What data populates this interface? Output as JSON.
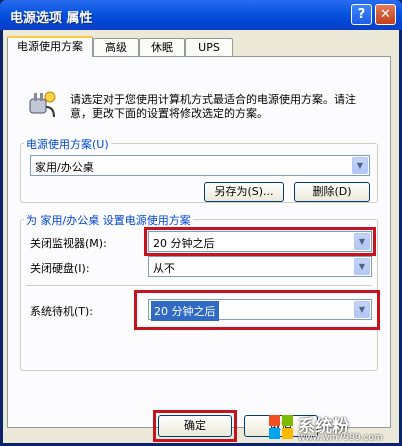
{
  "window": {
    "title": "电源选项 属性"
  },
  "tabs": [
    {
      "label": "电源使用方案"
    },
    {
      "label": "高级"
    },
    {
      "label": "休眠"
    },
    {
      "label": "UPS"
    }
  ],
  "intro_text": "请选定对于您使用计算机方式最适合的电源使用方案。请注意，更改下面的设置将修改选定的方案。",
  "scheme_group": {
    "title": "电源使用方案(U)",
    "selected": "家用/办公桌",
    "save_as": "另存为(S)...",
    "delete": "删除(D)"
  },
  "settings_group": {
    "title": "为 家用/办公桌 设置电源使用方案",
    "monitor_label": "关闭监视器(M):",
    "monitor_value": "20 分钟之后",
    "disk_label": "关闭硬盘(I):",
    "disk_value": "从不",
    "standby_label": "系统待机(T):",
    "standby_value": "20 分钟之后"
  },
  "buttons": {
    "ok": "确定",
    "partial": "取消"
  },
  "watermark": {
    "brand": "系统粉",
    "url": "www.win7999.com"
  },
  "colors": {
    "highlight": "#c8131f",
    "selection": "#316ac5"
  }
}
